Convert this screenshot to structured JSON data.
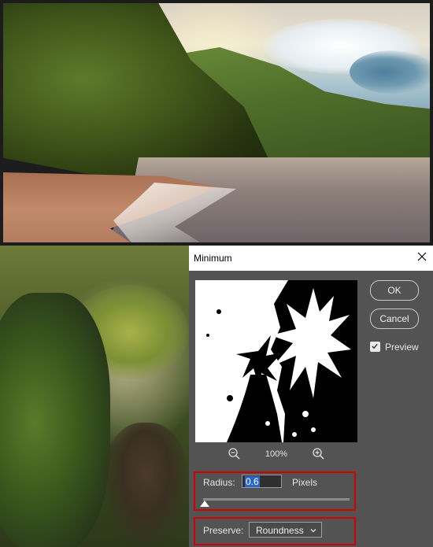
{
  "dialog": {
    "title": "Minimum",
    "close_icon": "close-icon",
    "ok_label": "OK",
    "cancel_label": "Cancel",
    "preview_label": "Preview",
    "preview_checked": true,
    "zoom_value": "100%",
    "zoom_out_icon": "zoom-out-icon",
    "zoom_in_icon": "zoom-in-icon",
    "radius": {
      "label": "Radius:",
      "value": "0.6",
      "unit": "Pixels"
    },
    "preserve": {
      "label": "Preserve:",
      "value": "Roundness"
    },
    "highlight_color": "#d00000"
  }
}
